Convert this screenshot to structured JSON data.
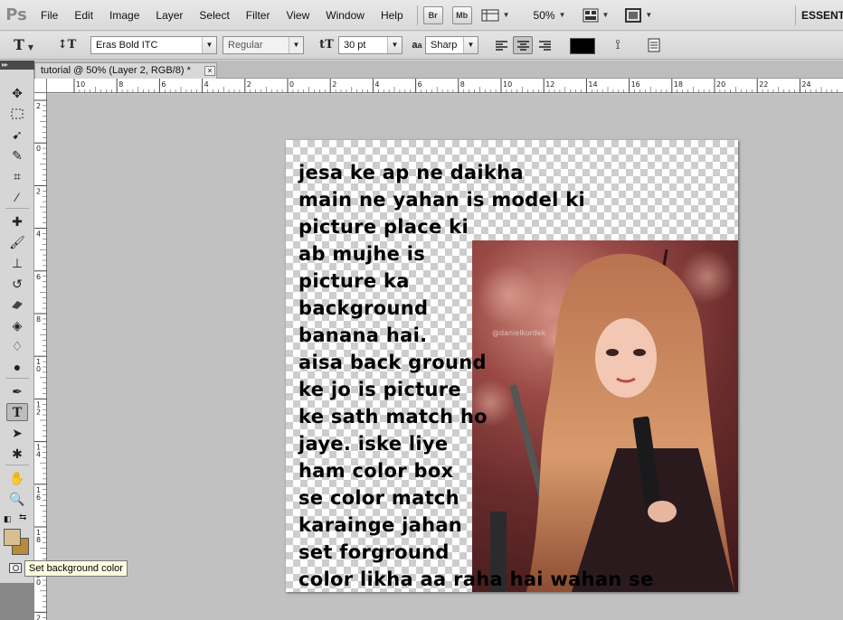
{
  "app": {
    "logo": "Ps",
    "menu": [
      "File",
      "Edit",
      "Image",
      "Layer",
      "Select",
      "Filter",
      "View",
      "Window",
      "Help"
    ],
    "bridge_label": "Br",
    "minibridge_label": "Mb",
    "zoom": "50%",
    "workspace": "ESSENTI"
  },
  "options": {
    "font_family": "Eras Bold ITC",
    "font_style": "Regular",
    "font_size": "30 pt",
    "aa_label": "a",
    "aa_label2": "a",
    "anti_alias": "Sharp",
    "text_color": "#000000"
  },
  "document": {
    "tab_title": "tutorial @ 50% (Layer 2, RGB/8) *",
    "close": "×",
    "text_lines": [
      "jesa ke ap ne daikha",
      "main ne yahan is model ki",
      "picture place ki",
      "ab mujhe is",
      "picture ka",
      "background",
      "banana hai.",
      "aisa back ground",
      "ke jo is picture",
      "ke sath match ho",
      "jaye. iske liye",
      "ham color box",
      "se color match",
      "karainge jahan",
      "set forground",
      "color likha aa raha hai wahan se"
    ],
    "watermark": "@danielkordek"
  },
  "rulers": {
    "top": [
      "10",
      "8",
      "6",
      "4",
      "2",
      "0",
      "2",
      "4",
      "6",
      "8",
      "10",
      "12",
      "14",
      "16",
      "18",
      "20",
      "22",
      "24"
    ],
    "left": [
      "2",
      "0",
      "2",
      "4",
      "6",
      "8",
      "1\n0",
      "1\n2",
      "1\n4",
      "1\n6",
      "1\n8",
      "2\n0",
      "2\n2"
    ]
  },
  "colors": {
    "foreground": "#d9bf8f",
    "background": "#b88a3a"
  },
  "tooltip": "Set background color"
}
